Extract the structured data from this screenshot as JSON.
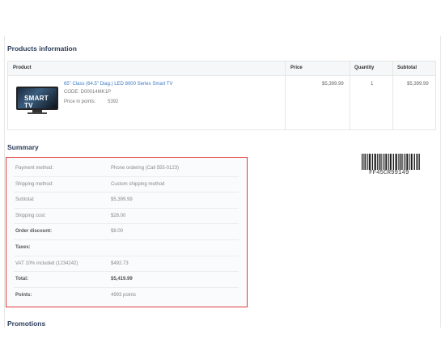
{
  "sections": {
    "products_title": "Products information",
    "summary_title": "Summary",
    "promotions_title": "Promotions"
  },
  "products_table": {
    "headers": [
      "Product",
      "Price",
      "Quantity",
      "Subtotal"
    ],
    "rows": [
      {
        "name": "65\" Class (64.5\" Diag.) LED 8000 Series Smart TV",
        "code": "CODE: D00014MK1P",
        "points_label": "Price in points:",
        "points_value": "5392",
        "image_text": "SMART TV",
        "price": "$5,399.99",
        "quantity": "1",
        "subtotal": "$5,399.99"
      }
    ]
  },
  "summary": {
    "rows": [
      {
        "label": "Payment method:",
        "value": "Phone ordering (Call 555-0123)",
        "bold": false
      },
      {
        "label": "Shipping method:",
        "value": "Custom shipping method",
        "bold": false
      },
      {
        "label": "Subtotal:",
        "value": "$5,399.99",
        "bold": false
      },
      {
        "label": "Shipping cost:",
        "value": "$28.00",
        "bold": false
      },
      {
        "label": "Order discount:",
        "value": "$8.00",
        "bold": true
      },
      {
        "label": "Taxes:",
        "value": "",
        "bold": true
      },
      {
        "label": "VAT 10% included (1234242)",
        "value": "$492.73",
        "bold": false
      },
      {
        "label": "Total:",
        "value": "$5,419.99",
        "bold": true
      },
      {
        "label": "Points:",
        "value": "4993 points",
        "bold": true
      }
    ]
  },
  "barcode": {
    "text": "FF45CR99149"
  },
  "colors": {
    "highlight_border": "#e03c3c",
    "link": "#3d7ac4",
    "heading": "#2c3e5a"
  }
}
